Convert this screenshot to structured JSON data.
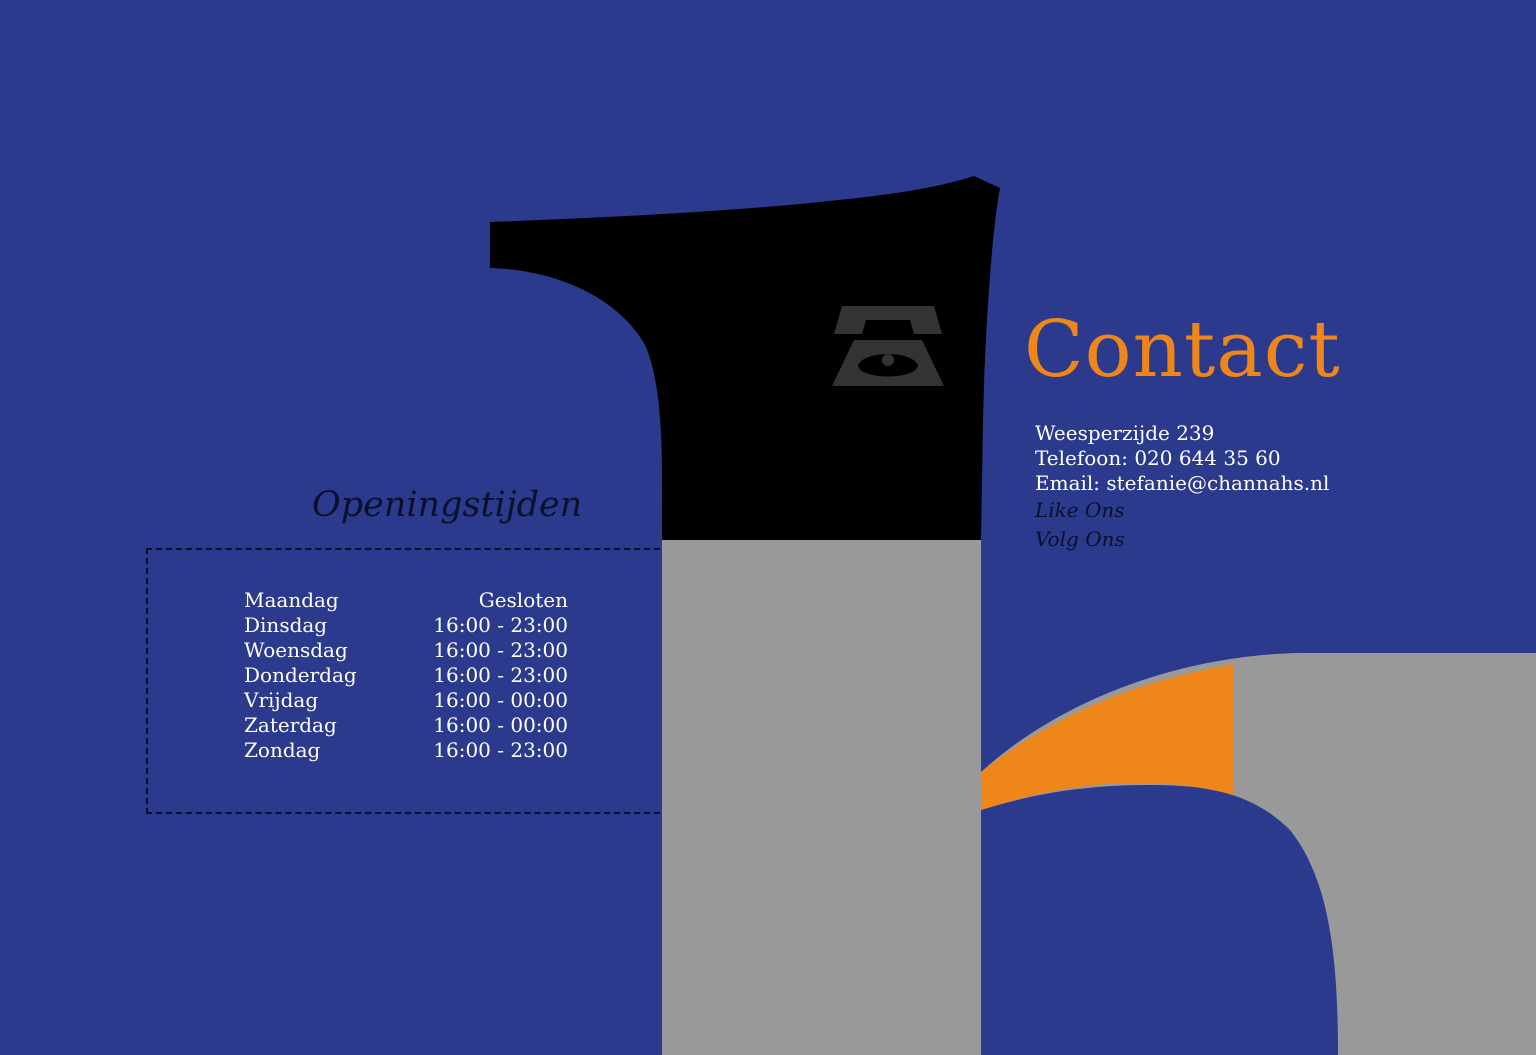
{
  "colors": {
    "background": "#2B3A8C",
    "accent": "#EF861A",
    "grey": "#999999",
    "black": "#000000",
    "text": "#FFFFFF",
    "dark_text": "#0b0f2a"
  },
  "contact": {
    "title": "Contact",
    "icon": "telephone-icon",
    "address": "Weesperzijde 239",
    "phone": "Telefoon: 020 644 35 60",
    "email": "Email: stefanie@channahs.nl",
    "like_label": "Like Ons",
    "follow_label": "Volg Ons"
  },
  "hours": {
    "title": "Openingstijden",
    "rows": [
      {
        "day": "Maandag",
        "time": "Gesloten"
      },
      {
        "day": "Dinsdag",
        "time": "16:00 - 23:00"
      },
      {
        "day": "Woensdag",
        "time": "16:00 - 23:00"
      },
      {
        "day": "Donderdag",
        "time": "16:00 - 23:00"
      },
      {
        "day": "Vrijdag",
        "time": "16:00 - 00:00"
      },
      {
        "day": "Zaterdag",
        "time": "16:00 - 00:00"
      },
      {
        "day": "Zondag",
        "time": "16:00 - 23:00"
      }
    ]
  }
}
